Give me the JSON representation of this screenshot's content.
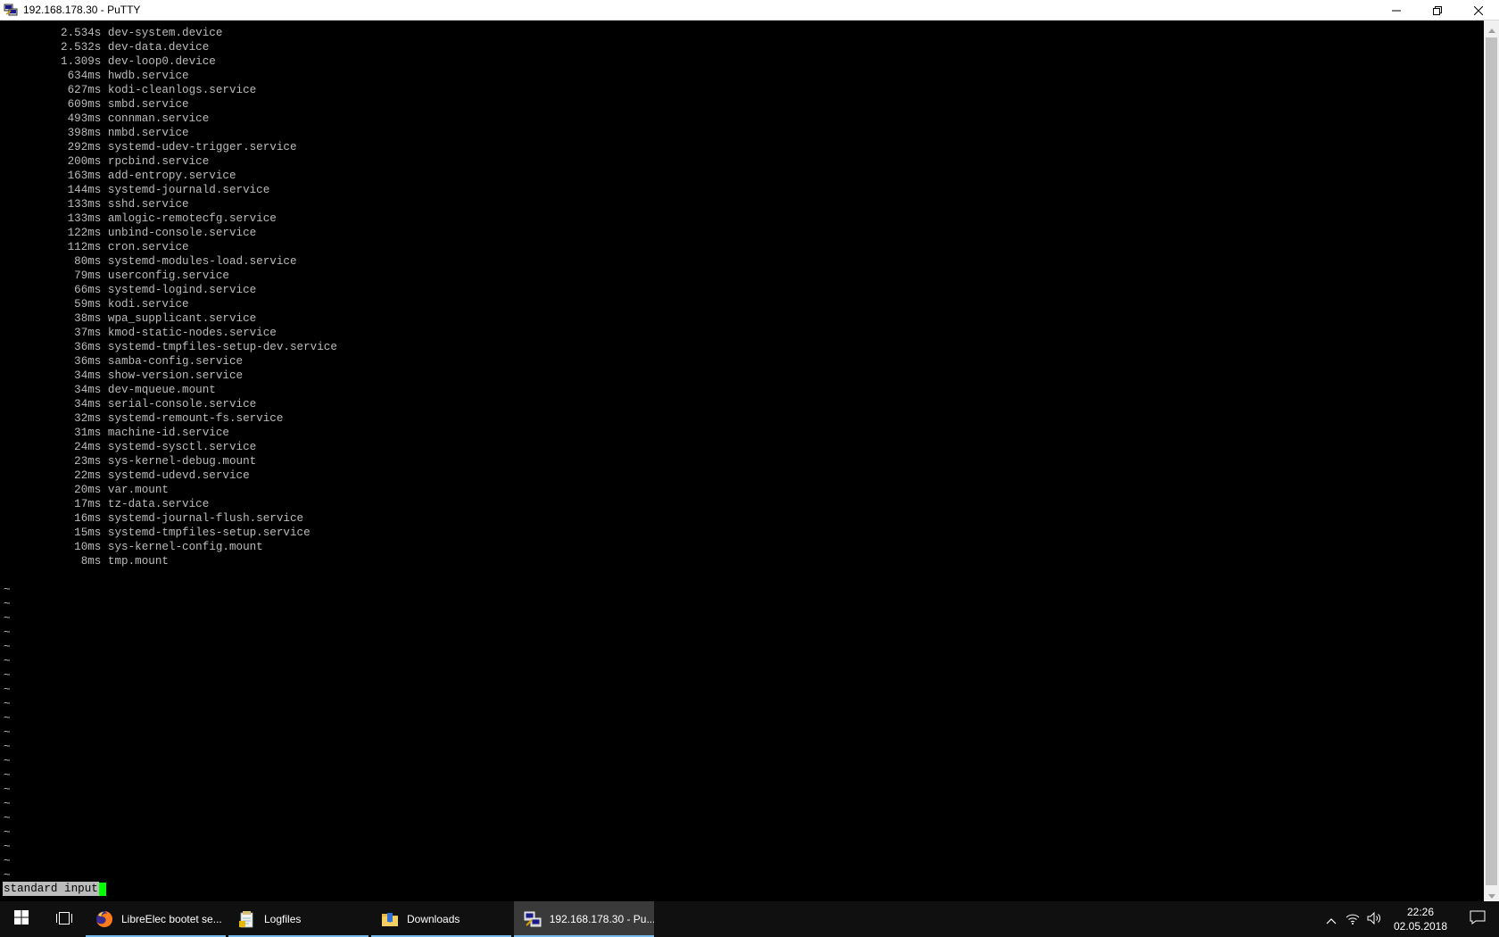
{
  "window": {
    "title": "192.168.178.30 - PuTTY",
    "icon": "putty-icon",
    "controls": [
      "minimize-icon",
      "restore-icon",
      "close-icon"
    ]
  },
  "terminal": {
    "lines": [
      "         2.534s dev-system.device",
      "         2.532s dev-data.device",
      "         1.309s dev-loop0.device",
      "          634ms hwdb.service",
      "          627ms kodi-cleanlogs.service",
      "          609ms smbd.service",
      "          493ms connman.service",
      "          398ms nmbd.service",
      "          292ms systemd-udev-trigger.service",
      "          200ms rpcbind.service",
      "          163ms add-entropy.service",
      "          144ms systemd-journald.service",
      "          133ms sshd.service",
      "          133ms amlogic-remotecfg.service",
      "          122ms unbind-console.service",
      "          112ms cron.service",
      "           80ms systemd-modules-load.service",
      "           79ms userconfig.service",
      "           66ms systemd-logind.service",
      "           59ms kodi.service",
      "           38ms wpa_supplicant.service",
      "           37ms kmod-static-nodes.service",
      "           36ms systemd-tmpfiles-setup-dev.service",
      "           36ms samba-config.service",
      "           34ms show-version.service",
      "           34ms dev-mqueue.mount",
      "           34ms serial-console.service",
      "           32ms systemd-remount-fs.service",
      "           31ms machine-id.service",
      "           24ms systemd-sysctl.service",
      "           23ms sys-kernel-debug.mount",
      "           22ms systemd-udevd.service",
      "           20ms var.mount",
      "           17ms tz-data.service",
      "           16ms systemd-journal-flush.service",
      "           15ms systemd-tmpfiles-setup.service",
      "           10ms sys-kernel-config.mount",
      "            8ms tmp.mount"
    ],
    "tildes": [
      "~",
      "~",
      "~",
      "~",
      "~",
      "~",
      "~",
      "~",
      "~",
      "~",
      "~",
      "~",
      "~",
      "~",
      "~",
      "~",
      "~",
      "~",
      "~",
      "~",
      "~"
    ],
    "status": "standard input"
  },
  "taskbar": {
    "items": [
      {
        "label": "LibreElec bootet se...",
        "icon": "firefox-icon",
        "active": false
      },
      {
        "label": "Logfiles",
        "icon": "notepad-icon",
        "active": false
      },
      {
        "label": "Downloads",
        "icon": "folder-icon",
        "active": false
      },
      {
        "label": "192.168.178.30 - Pu...",
        "icon": "putty-icon",
        "active": true
      }
    ],
    "tray": {
      "icons": [
        "chevron-up-icon",
        "network-icon",
        "volume-icon"
      ],
      "time": "22:26",
      "date": "02.05.2018"
    }
  },
  "colors": {
    "terminal_bg": "#000000",
    "terminal_fg": "#bbbbbb",
    "cursor": "#00ff00",
    "taskbar_bg": "#101010",
    "taskbar_accent": "#76b9ed"
  }
}
